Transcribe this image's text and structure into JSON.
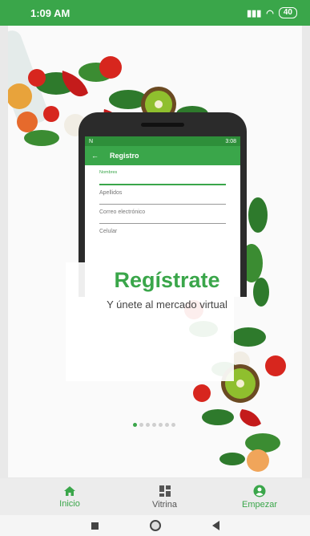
{
  "status_bar": {
    "time": "1:09 AM",
    "battery": "40"
  },
  "phone_mockup": {
    "status_time": "3:08",
    "appbar_title": "Registro",
    "fields": [
      {
        "label": "Nombres"
      },
      {
        "label": "Apellidos"
      },
      {
        "label": "Correo electrónico"
      },
      {
        "label": "Celular"
      }
    ]
  },
  "hero": {
    "title": "Regístrate",
    "subtitle": "Y únete al mercado virtual"
  },
  "pager": {
    "count": 7,
    "active_index": 0
  },
  "bottom_nav": {
    "items": [
      {
        "label": "Inicio",
        "icon": "home-icon",
        "active": true
      },
      {
        "label": "Vitrina",
        "icon": "dashboard-icon",
        "active": false
      },
      {
        "label": "Empezar",
        "icon": "account-circle-icon",
        "active": true
      }
    ]
  },
  "colors": {
    "accent": "#3aa64a",
    "status_bar": "#3aa64a"
  }
}
